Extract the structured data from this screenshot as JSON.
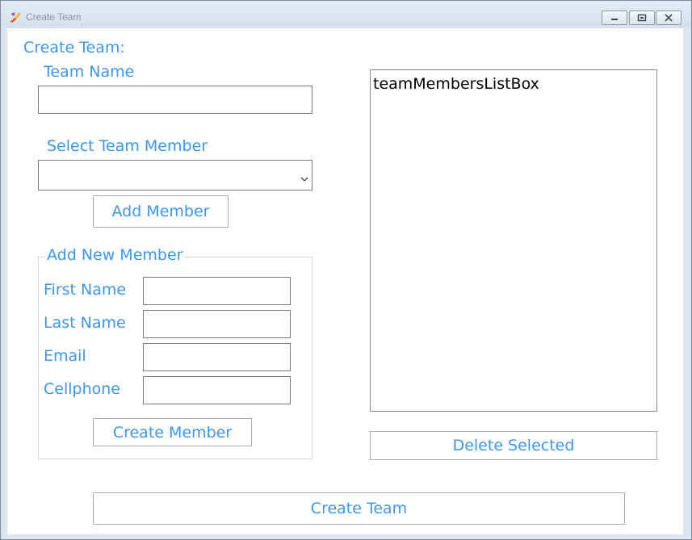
{
  "window": {
    "title": "Create Team",
    "icon": "app-brush-icon",
    "controls": [
      "minimize-icon",
      "restore-icon",
      "close-icon"
    ]
  },
  "form": {
    "heading": "Create Team:",
    "team_name_label": "Team Name",
    "team_name_value": "",
    "select_member_label": "Select Team Member",
    "select_member_value": "",
    "add_member_button": "Add Member",
    "new_member_group": {
      "legend": "Add New Member",
      "first_name_label": "First Name",
      "last_name_label": "Last Name",
      "email_label": "Email",
      "cellphone_label": "Cellphone",
      "create_member_button": "Create Member"
    },
    "members_list": {
      "items": [
        "teamMembersListBox"
      ]
    },
    "delete_selected_button": "Delete Selected",
    "create_team_button": "Create Team"
  },
  "colors": {
    "accent_text": "#3c97e8",
    "window_frame": "#dde6f0"
  }
}
